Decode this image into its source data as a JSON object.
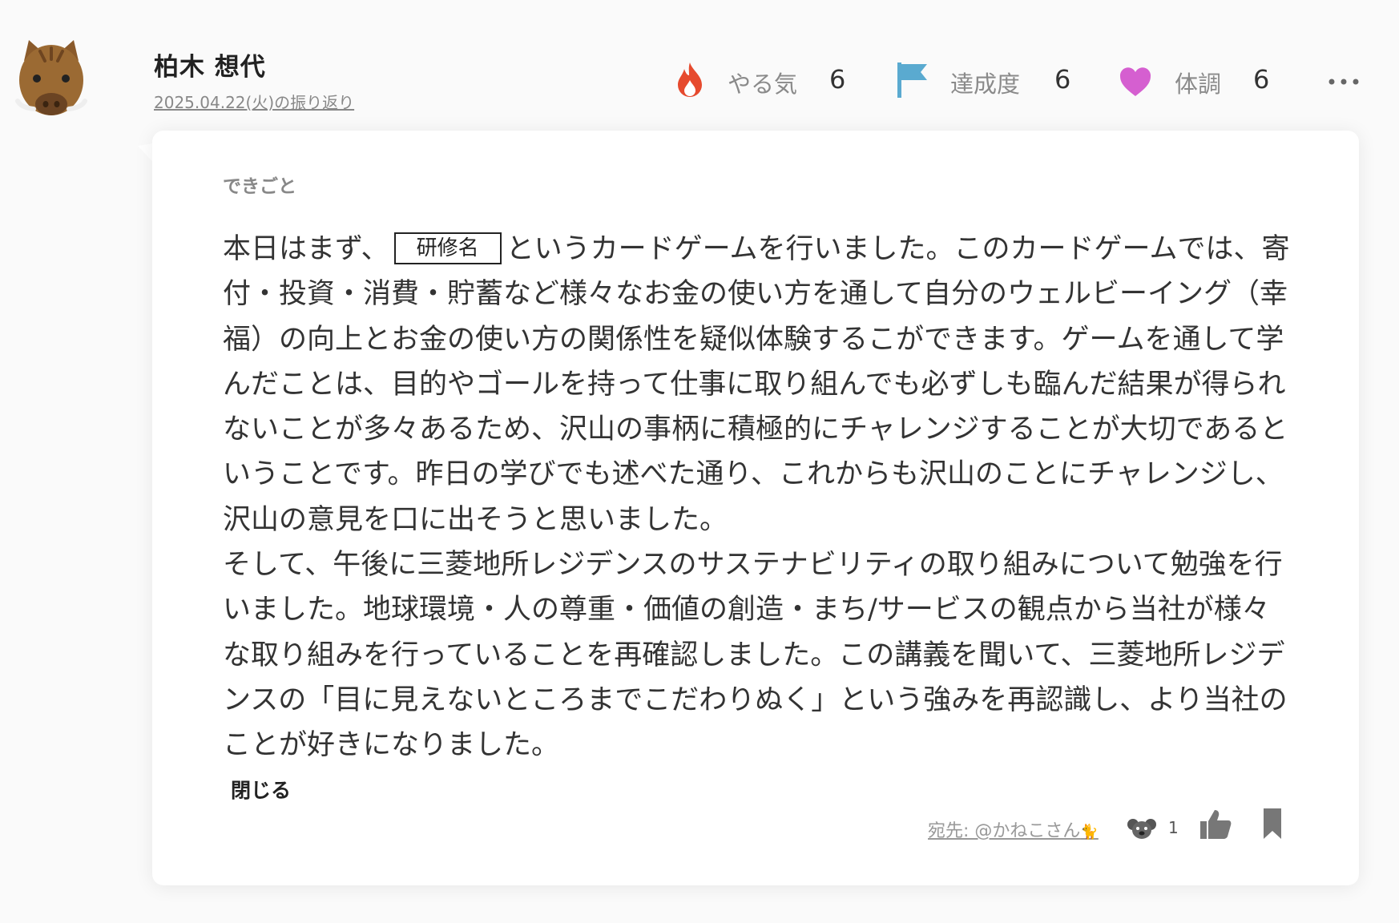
{
  "author": {
    "name": "柏木 想代",
    "date_link": "2025.04.22(火)の振り返り"
  },
  "stats": [
    {
      "label": "やる気",
      "value": "6",
      "icon": "fire-icon",
      "color": "#e64a2e"
    },
    {
      "label": "達成度",
      "value": "6",
      "icon": "flag-icon",
      "color": "#5aaad0"
    },
    {
      "label": "体調",
      "value": "6",
      "icon": "heart-icon",
      "color": "#d55fd0"
    }
  ],
  "card": {
    "section_label": "できごと",
    "text_before_box": "本日はまず、",
    "box_label": "研修名",
    "text_after_box": "というカードゲームを行いました。このカードゲームでは、寄付・投資・消費・貯蓄など様々なお金の使い方を通して自分のウェルビーイング（幸福）の向上とお金の使い方の関係性を疑似体験するこができます。ゲームを通して学んだことは、目的やゴールを持って仕事に取り組んでも必ずしも臨んだ結果が得られないことが多々あるため、沢山の事柄に積極的にチャレンジすることが大切であるということです。昨日の学びでも述べた通り、これからも沢山のことにチャレンジし、沢山の意見を口に出そうと思いました。",
    "paragraph_2": "そして、午後に三菱地所レジデンスのサステナビリティの取り組みについて勉強を行いました。地球環境・人の尊重・価値の創造・まち/サービスの観点から当社が様々な取り組みを行っていることを再確認しました。この講義を聞いて、三菱地所レジデンスの「目に見えないところまでこだわりぬく」という強みを再認識し、より当社のことが好きになりました。",
    "close_label": "閉じる",
    "recipient": "宛先: @かねこさん",
    "reaction_count": "1"
  }
}
